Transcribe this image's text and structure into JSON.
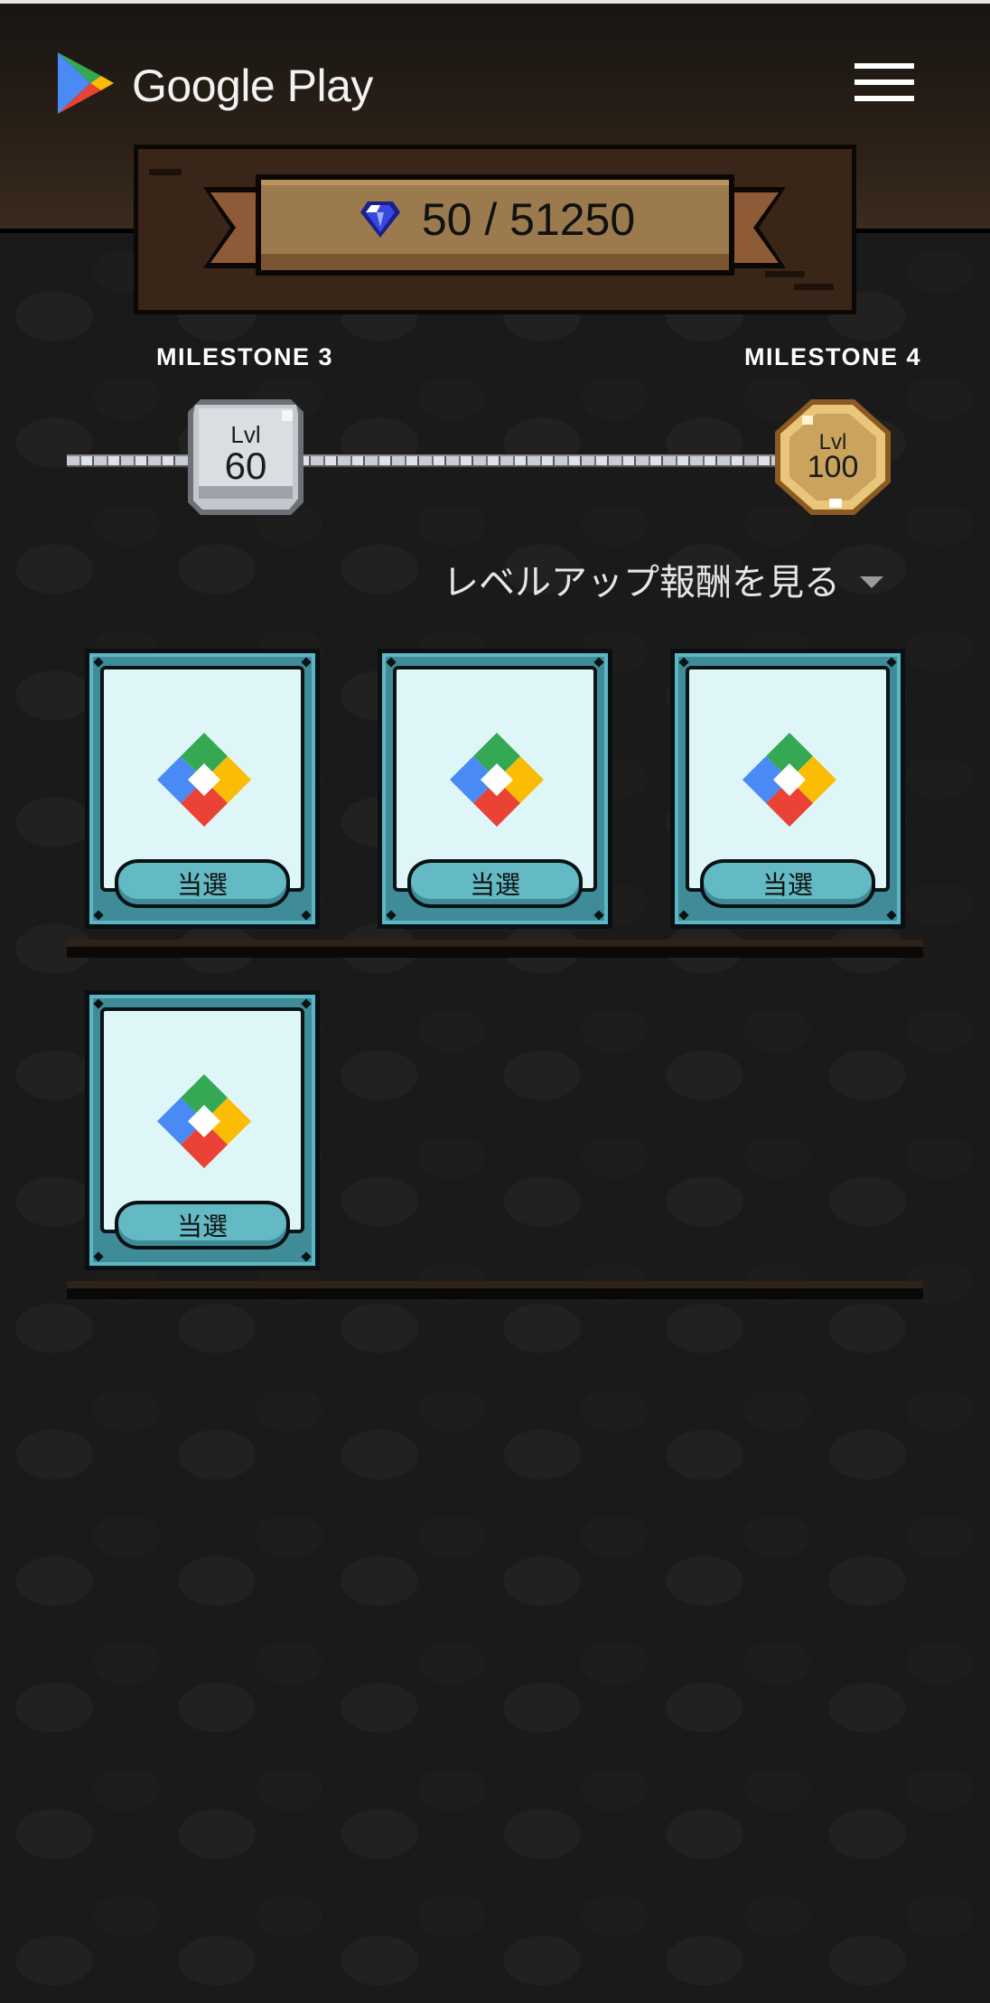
{
  "header": {
    "brand": "Google Play",
    "menu_icon": "hamburger-menu-icon"
  },
  "score": {
    "value": "50 / 51250",
    "icon": "gem-icon"
  },
  "milestones": {
    "left": {
      "label": "MILESTONE 3",
      "lvl": "Lvl",
      "level": "60",
      "tier": "silver"
    },
    "right": {
      "label": "MILESTONE 4",
      "lvl": "Lvl",
      "level": "100",
      "tier": "gold"
    }
  },
  "levelup": {
    "label": "レベルアップ報酬を見る"
  },
  "rewards": [
    {
      "label": "当選"
    },
    {
      "label": "当選"
    },
    {
      "label": "当選"
    },
    {
      "label": "当選"
    }
  ],
  "colors": {
    "card": "#3f8c98",
    "card_inner": "#dff6f8",
    "ribbon": "#9a7a4d",
    "topbar": "#2a2017"
  }
}
